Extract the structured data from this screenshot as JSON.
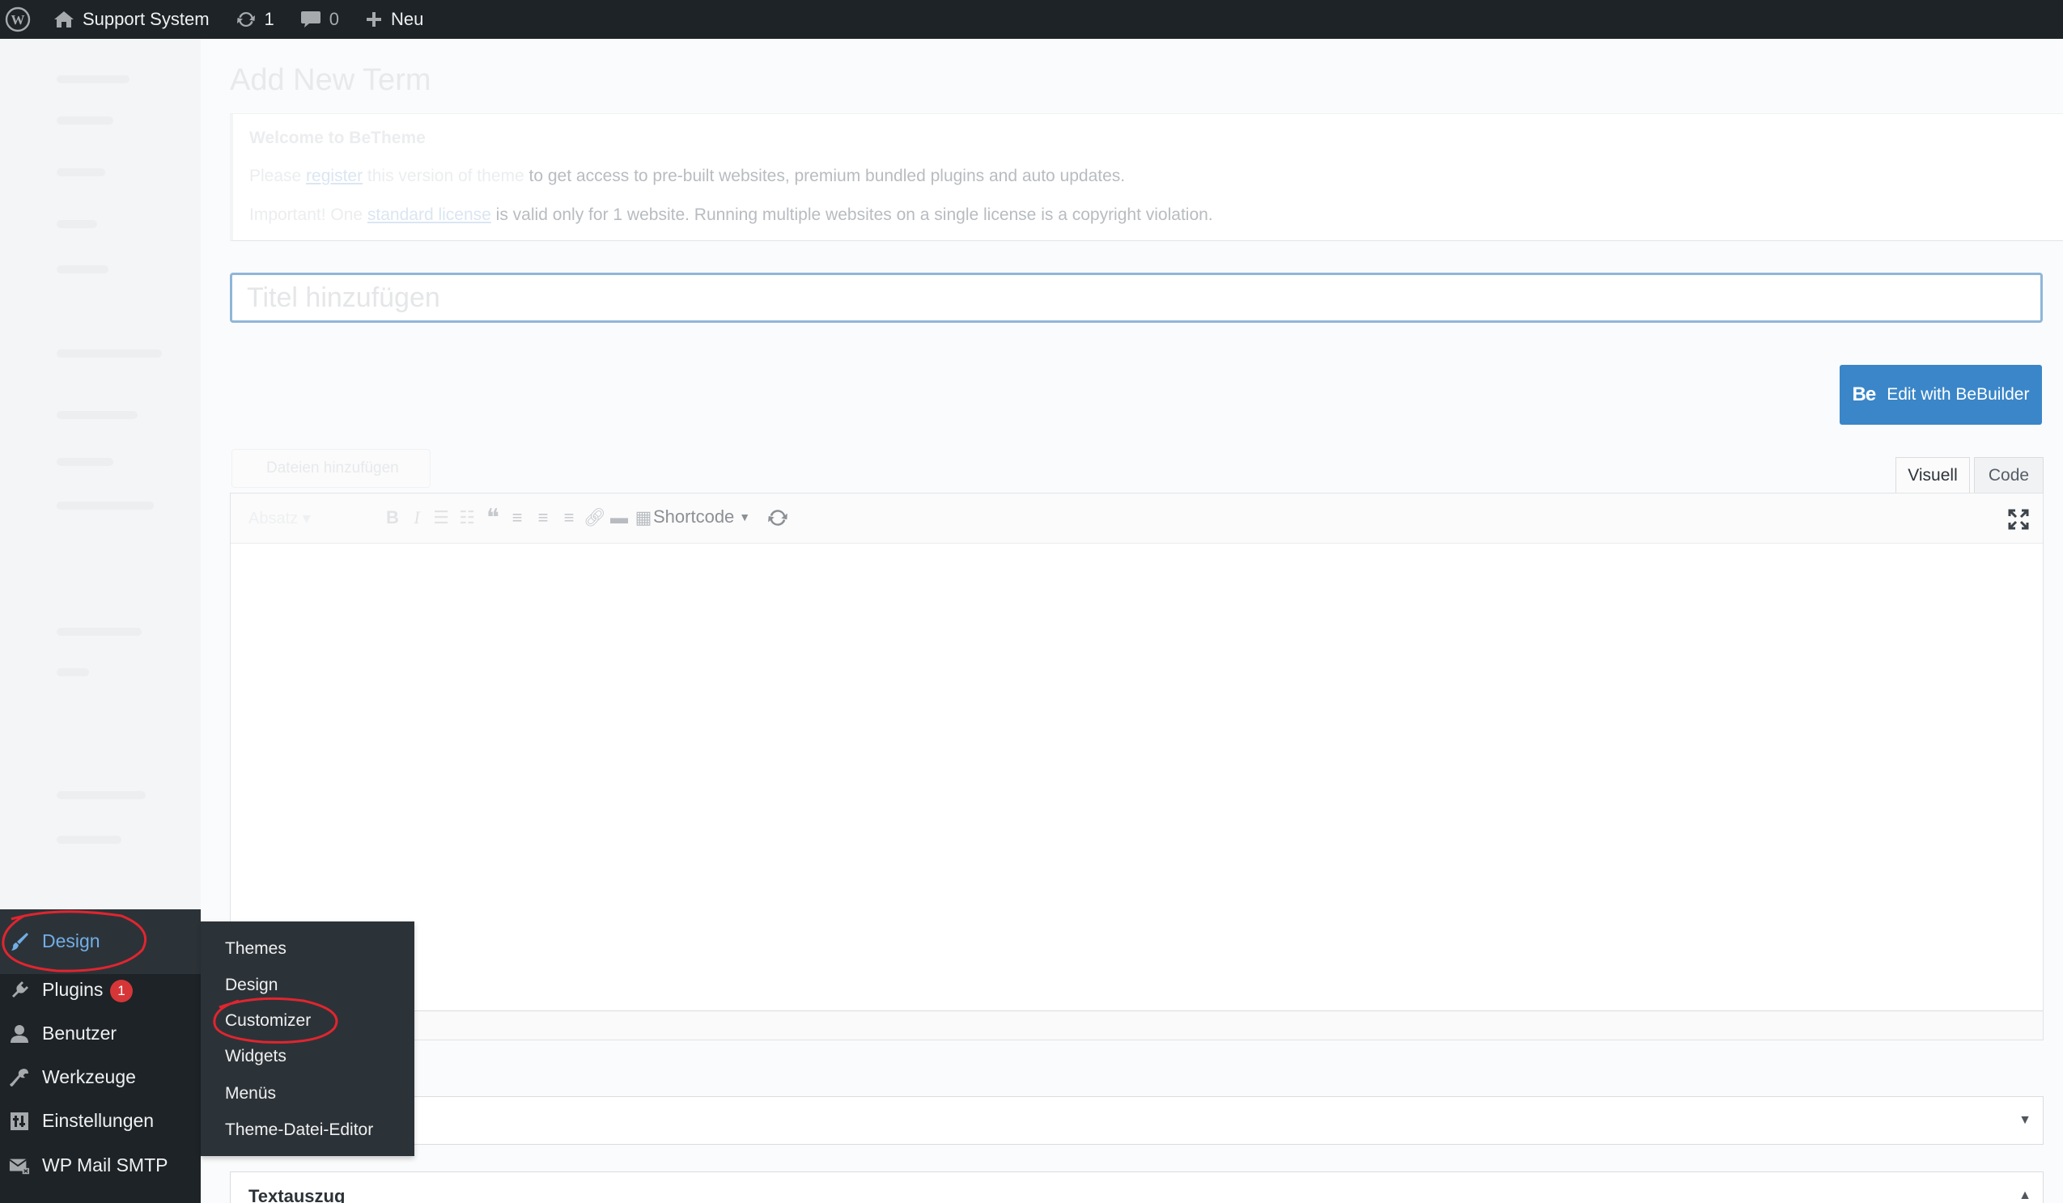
{
  "admin_bar": {
    "site_name": "Support System",
    "updates_count": "1",
    "comments_count": "0",
    "new_label": "Neu"
  },
  "main": {
    "page_heading": "Add New Term",
    "notice": {
      "title": "Welcome to BeTheme",
      "line1_prefix": "Please ",
      "line1_link": "register",
      "line1_mid": " this version of theme ",
      "line1_suffix": "to get access to pre-built websites, premium bundled plugins and auto updates.",
      "line2_prefix": "Important! One ",
      "line2_link": "standard license",
      "line2_suffix": " is valid only for 1 website. Running multiple websites on a single license is a copyright violation."
    },
    "title_placeholder": "Titel hinzufügen",
    "bebuilder_logo": "Be",
    "bebuilder_label": "Edit with BeBuilder",
    "add_media_label": "Dateien hinzufügen",
    "tab_visual": "Visuell",
    "tab_code": "Code",
    "paragraph_select": "Absatz",
    "shortcode_label": "Shortcode",
    "excerpt_title": "Textauszug"
  },
  "admin_menu": {
    "items": [
      {
        "label": "Design",
        "icon": "paintbrush-icon"
      },
      {
        "label": "Plugins",
        "icon": "plugin-icon",
        "badge": "1"
      },
      {
        "label": "Benutzer",
        "icon": "user-icon"
      },
      {
        "label": "Werkzeuge",
        "icon": "wrench-icon"
      },
      {
        "label": "Einstellungen",
        "icon": "settings-icon"
      },
      {
        "label": "WP Mail SMTP",
        "icon": "mail-icon"
      }
    ]
  },
  "design_submenu": [
    {
      "label": "Themes"
    },
    {
      "label": "Design"
    },
    {
      "label": "Customizer"
    },
    {
      "label": "Widgets"
    },
    {
      "label": "Menüs"
    },
    {
      "label": "Theme-Datei-Editor"
    }
  ],
  "colors": {
    "admin_dark": "#1d2327",
    "submenu_bg": "#2c3338",
    "active_blue": "#72aee6",
    "primary_button": "#3a86c8",
    "badge_red": "#d63638",
    "annotation_red": "#e1252f"
  }
}
